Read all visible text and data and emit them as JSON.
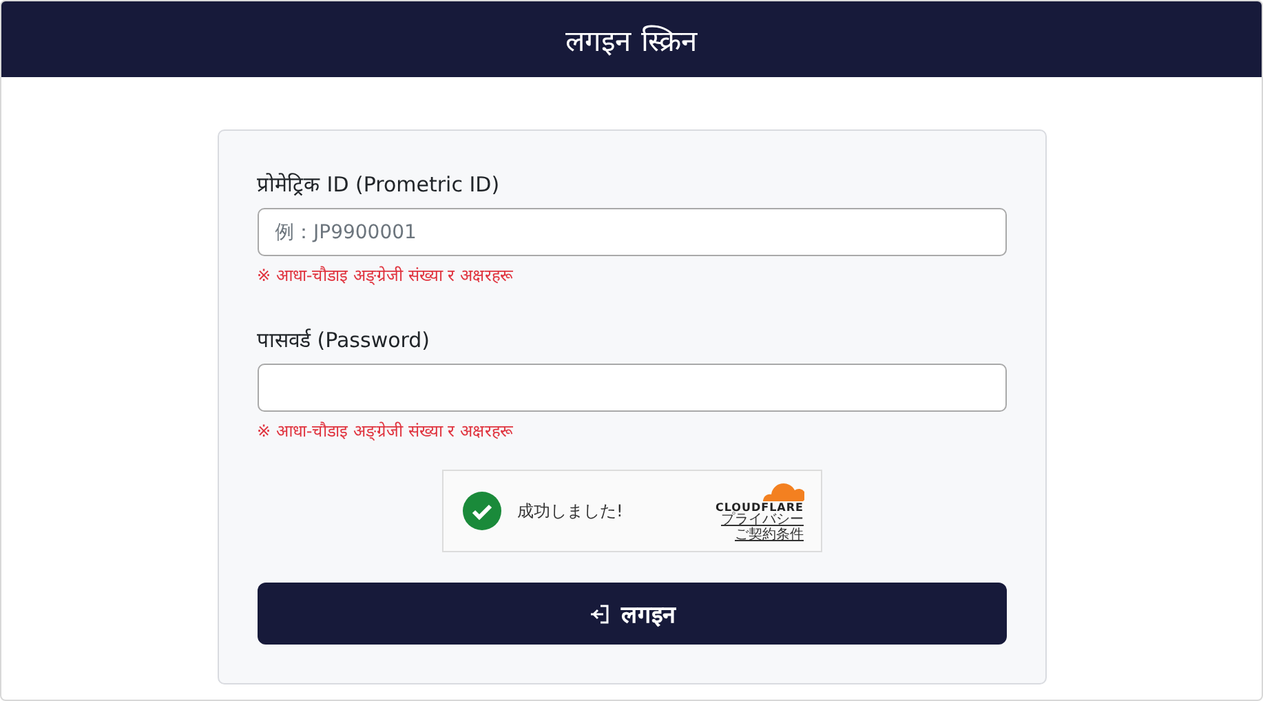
{
  "header": {
    "title": "लगइन स्क्रिन"
  },
  "fields": [
    {
      "label": "प्रोमेट्रिक ID (Prometric ID)",
      "placeholder": "例：JP9900001",
      "hint": "※ आधा-चौडाइ अङ्ग्रेजी संख्या र अक्षरहरू"
    },
    {
      "label": "पासवर्ड (Password)",
      "hint": "※ आधा-चौडाइ अङ्ग्रेजी संख्या र अक्षरहरू"
    }
  ],
  "captcha": {
    "status": "成功しました!",
    "brand": "CLOUDFLARE",
    "links": [
      "プライバシー",
      "ご契約条件"
    ]
  },
  "submit": {
    "label": "लगइन"
  }
}
